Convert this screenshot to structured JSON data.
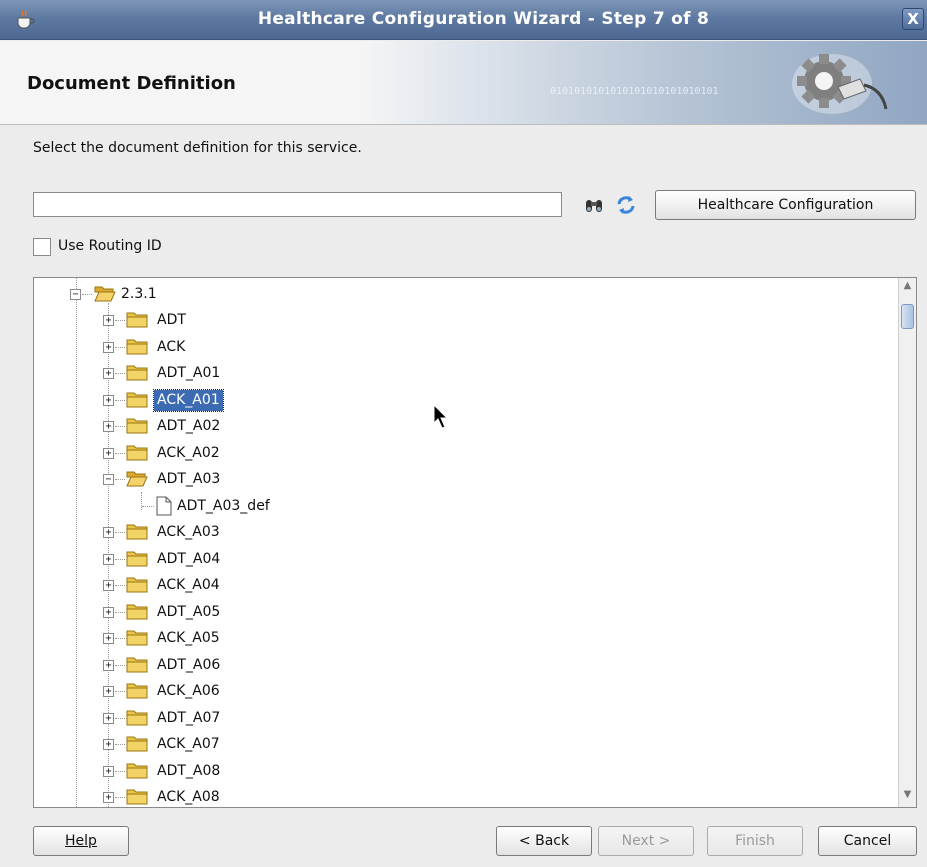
{
  "window": {
    "title": "Healthcare Configuration Wizard - Step 7 of 8",
    "close_label": "X"
  },
  "header": {
    "heading": "Document Definition",
    "banner_bits": "0101010101010101010101010101"
  },
  "instruction": "Select the document definition for this service.",
  "search": {
    "value": "",
    "placeholder": ""
  },
  "healthcare_button": "Healthcare Configuration",
  "use_routing_id": {
    "label": "Use Routing ID",
    "checked": false
  },
  "tree": {
    "root": {
      "label": "2.3.1",
      "expanded": true
    },
    "selected": "ACK_A01",
    "items": [
      {
        "label": "ADT",
        "type": "folder",
        "expanded": false
      },
      {
        "label": "ACK",
        "type": "folder",
        "expanded": false
      },
      {
        "label": "ADT_A01",
        "type": "folder",
        "expanded": false
      },
      {
        "label": "ACK_A01",
        "type": "folder",
        "expanded": false
      },
      {
        "label": "ADT_A02",
        "type": "folder",
        "expanded": false
      },
      {
        "label": "ACK_A02",
        "type": "folder",
        "expanded": false
      },
      {
        "label": "ADT_A03",
        "type": "folder",
        "expanded": true
      },
      {
        "label": "ADT_A03_def",
        "type": "document"
      },
      {
        "label": "ACK_A03",
        "type": "folder",
        "expanded": false
      },
      {
        "label": "ADT_A04",
        "type": "folder",
        "expanded": false
      },
      {
        "label": "ACK_A04",
        "type": "folder",
        "expanded": false
      },
      {
        "label": "ADT_A05",
        "type": "folder",
        "expanded": false
      },
      {
        "label": "ACK_A05",
        "type": "folder",
        "expanded": false
      },
      {
        "label": "ADT_A06",
        "type": "folder",
        "expanded": false
      },
      {
        "label": "ACK_A06",
        "type": "folder",
        "expanded": false
      },
      {
        "label": "ADT_A07",
        "type": "folder",
        "expanded": false
      },
      {
        "label": "ACK_A07",
        "type": "folder",
        "expanded": false
      },
      {
        "label": "ADT_A08",
        "type": "folder",
        "expanded": false
      },
      {
        "label": "ACK_A08",
        "type": "folder",
        "expanded": false
      }
    ]
  },
  "buttons": {
    "help": {
      "label": "Help",
      "enabled": true
    },
    "back": {
      "label": "< Back",
      "enabled": true
    },
    "next": {
      "label": "Next >",
      "enabled": false
    },
    "finish": {
      "label": "Finish",
      "enabled": false
    },
    "cancel": {
      "label": "Cancel",
      "enabled": true
    }
  },
  "colors": {
    "titlebar": "#5f7aa2",
    "selection": "#3d6bb3",
    "folder": "#e9c64a"
  }
}
